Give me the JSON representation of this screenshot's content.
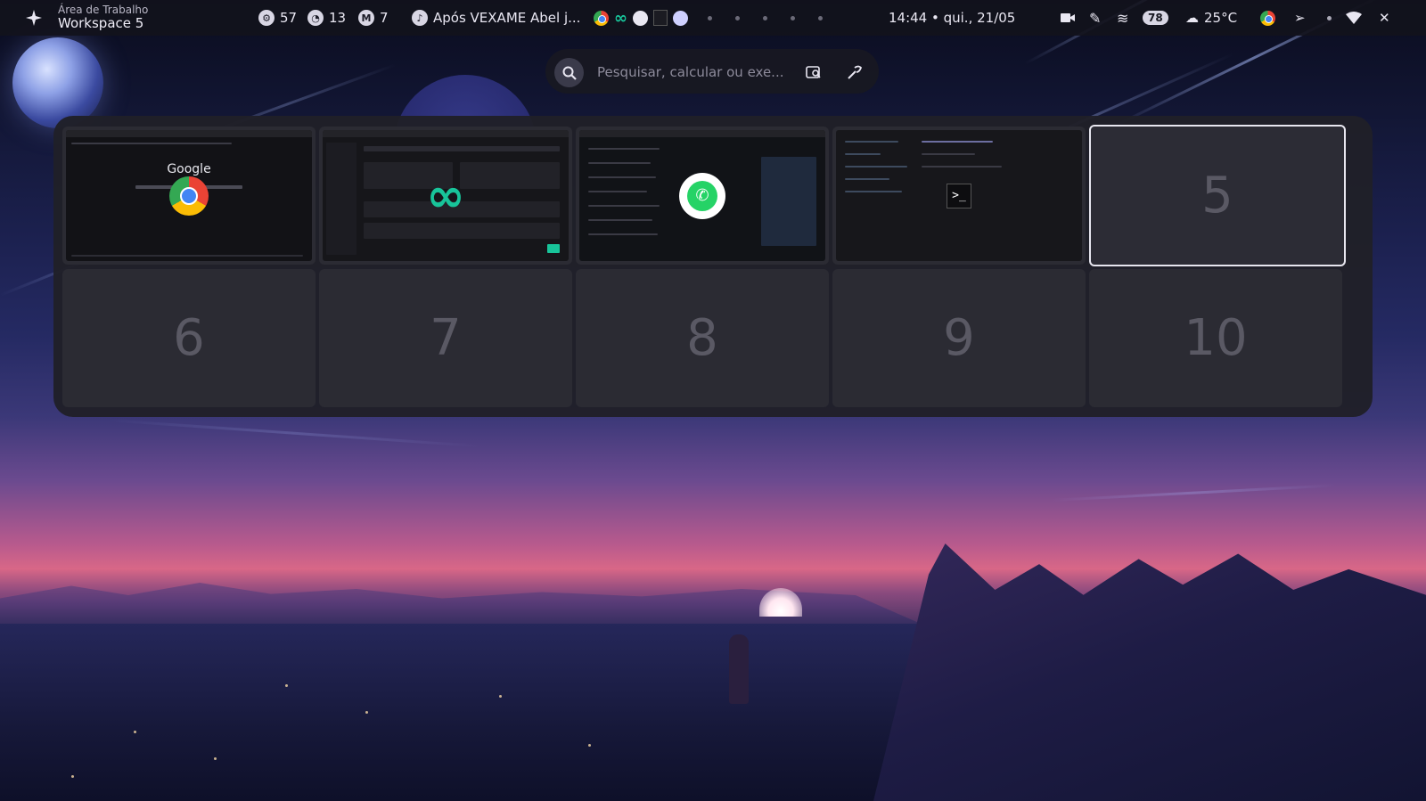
{
  "topbar": {
    "workspace_caption": "Área de Trabalho",
    "workspace_name": "Workspace 5",
    "stat_cpu": "57",
    "stat_mem": "13",
    "stat_other": "7",
    "media_title": "Após VEXAME Abel j...",
    "clock": "14:44 • qui., 21/05",
    "battery": "78",
    "weather": "25°C"
  },
  "search": {
    "placeholder": "Pesquisar, calcular ou exe..."
  },
  "overview": {
    "workspaces": [
      "5",
      "6",
      "7",
      "8",
      "9",
      "10"
    ],
    "active_workspace": "5",
    "google_label": "Google"
  },
  "icons": {
    "launcher": "sparkle-icon",
    "search": "search-icon",
    "screenshot": "image-search-icon",
    "color_picker": "color-picker-icon"
  },
  "colors": {
    "accent": "#e7e6ef",
    "panel": "#202028",
    "whatsapp": "#25d366",
    "infinity": "#18c49a"
  }
}
